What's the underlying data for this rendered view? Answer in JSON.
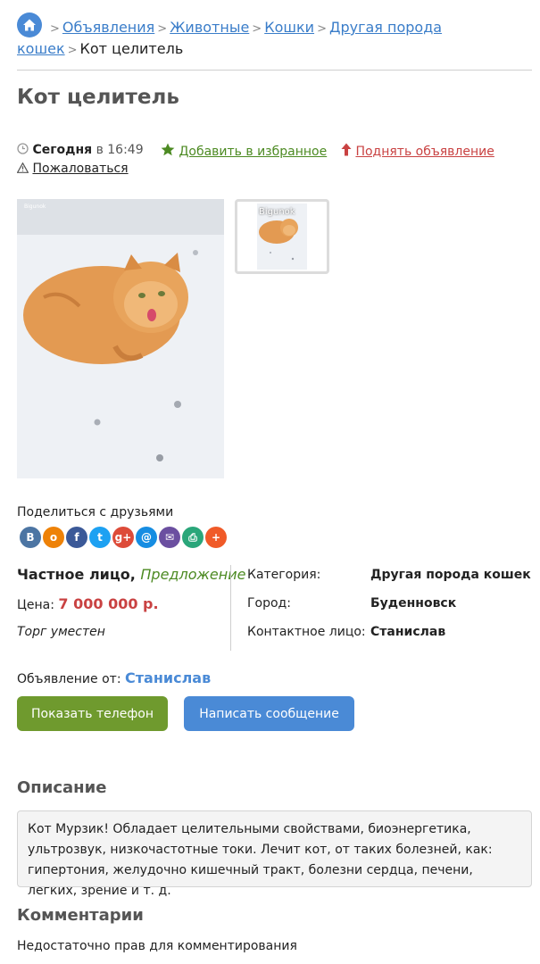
{
  "breadcrumb": {
    "items": [
      "Объявления",
      "Животные",
      "Кошки",
      "Другая порода кошек"
    ],
    "current": "Кот целитель"
  },
  "ad": {
    "title": "Кот целитель",
    "date_label": "Сегодня",
    "time_text": "в 16:49",
    "favorite_label": "Добавить в избранное",
    "raise_label": "Поднять объявление",
    "complain_label": "Пожаловаться"
  },
  "gallery": {
    "main_alt": "Рыжий кот на снегу",
    "watermark": "Bigunok"
  },
  "share": {
    "title": "Поделиться с друзьями",
    "icons": [
      {
        "name": "vk-icon",
        "glyph": "В",
        "color": "#4c75a3"
      },
      {
        "name": "ok-icon",
        "glyph": "o",
        "color": "#ee8208"
      },
      {
        "name": "facebook-icon",
        "glyph": "f",
        "color": "#3b5998"
      },
      {
        "name": "twitter-icon",
        "glyph": "t",
        "color": "#1da1f2"
      },
      {
        "name": "googleplus-icon",
        "glyph": "g+",
        "color": "#dd4b39"
      },
      {
        "name": "mailru-icon",
        "glyph": "@",
        "color": "#168de2"
      },
      {
        "name": "email-icon",
        "glyph": "✉",
        "color": "#6b4fa0"
      },
      {
        "name": "print-icon",
        "glyph": "⎙",
        "color": "#2aa67a"
      },
      {
        "name": "more-icon",
        "glyph": "+",
        "color": "#f05a28"
      }
    ]
  },
  "seller": {
    "type": "Частное лицо,",
    "offer": "Предложение",
    "price_label": "Цена:",
    "price": "7 000 000 р.",
    "bargain": "Торг уместен"
  },
  "details": {
    "rows": [
      {
        "label": "Категория:",
        "value": "Другая порода кошек"
      },
      {
        "label": "Город:",
        "value": "Буденновск"
      },
      {
        "label": "Контактное лицо:",
        "value": "Станислав"
      }
    ]
  },
  "author": {
    "label": "Объявление от:",
    "name": "Станислав"
  },
  "actions": {
    "phone": "Показать телефон",
    "message": "Написать сообщение"
  },
  "description": {
    "title": "Описание",
    "text": "Кот Мурзик! Обладает целительными свойствами, биоэнергетика, ультрозвук, низкочастотные токи. Лечит кот, от таких болезней, как: гипертония, желудочно кишечный тракт, болезни сердца, печени, легких, зрение и т. д."
  },
  "comments": {
    "title": "Комментарии",
    "notice": "Недостаточно прав для комментирования"
  }
}
